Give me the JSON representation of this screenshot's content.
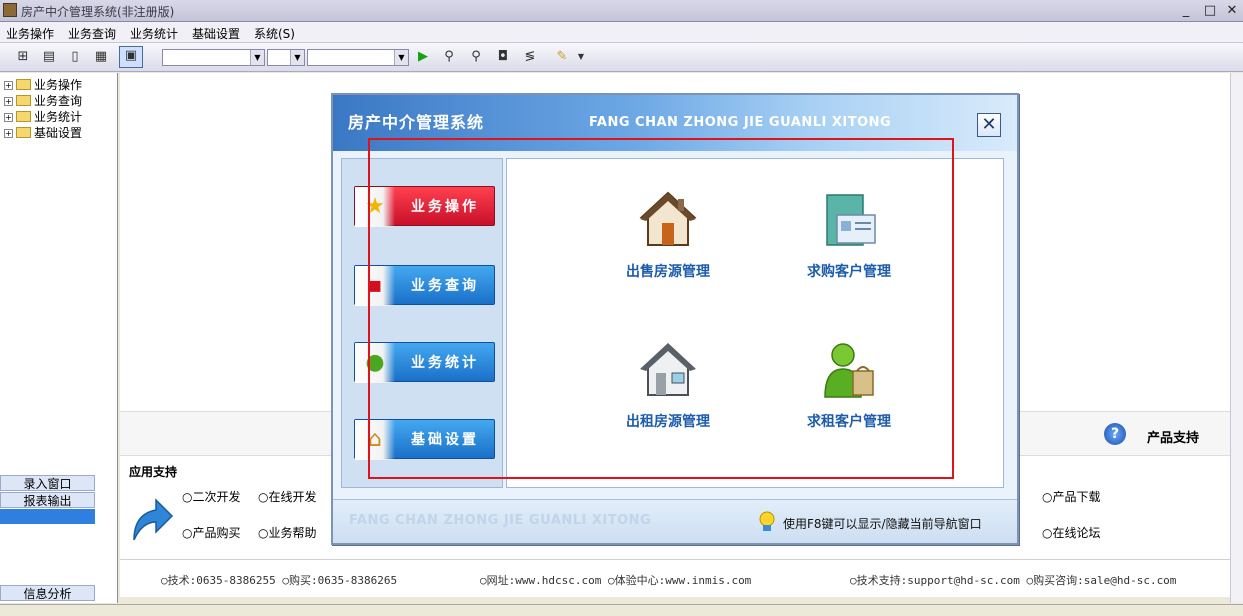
{
  "window": {
    "title": "房产中介管理系统(非注册版)",
    "controls": {
      "minimize": "_",
      "maximize": "□",
      "close": "✕"
    }
  },
  "menu": [
    "业务操作",
    "业务查询",
    "业务统计",
    "基础设置",
    "系统(S)"
  ],
  "tree": [
    "业务操作",
    "业务查询",
    "业务统计",
    "基础设置"
  ],
  "side_buttons": {
    "entry": "录入窗口",
    "report": "报表输出",
    "analysis": "信息分析"
  },
  "midbar": {
    "product_support": "产品支持"
  },
  "support": {
    "heading": "应用支持",
    "links_left": [
      "二次开发",
      "在线开发",
      "产品购买",
      "业务帮助"
    ],
    "links_right": [
      "产品下载",
      "在线论坛"
    ]
  },
  "footer": {
    "tech_phone": "技术:0635-8386255",
    "buy_phone": "购买:0635-8386265",
    "website": "网址:www.hdcsc.com",
    "experience": "体验中心:www.inmis.com",
    "support_email": "技术支持:support@hd-sc.com",
    "sales_email": "购买咨询:sale@hd-sc.com"
  },
  "dialog": {
    "title_cn": "房产中介管理系统",
    "title_en": "FANG CHAN ZHONG JIE GUANLI XITONG",
    "nav": [
      {
        "label": "业务操作",
        "icon": "star-icon",
        "color": "#d81b30"
      },
      {
        "label": "业务查询",
        "icon": "monitor-alert-icon",
        "color": "#1a70c8"
      },
      {
        "label": "业务统计",
        "icon": "person-bag-icon",
        "color": "#1a70c8"
      },
      {
        "label": "基础设置",
        "icon": "house-gold-icon",
        "color": "#1a70c8"
      }
    ],
    "tiles": [
      {
        "label": "出售房源管理",
        "icon": "house-brown-icon"
      },
      {
        "label": "求购客户管理",
        "icon": "contact-card-icon"
      },
      {
        "label": "出租房源管理",
        "icon": "house-gray-icon"
      },
      {
        "label": "求租客户管理",
        "icon": "person-shopping-icon"
      }
    ],
    "footer_en": "FANG CHAN ZHONG JIE GUANLI XITONG",
    "tip": "使用F8键可以显示/隐藏当前导航窗口"
  },
  "highlight_color": "#e0131a"
}
